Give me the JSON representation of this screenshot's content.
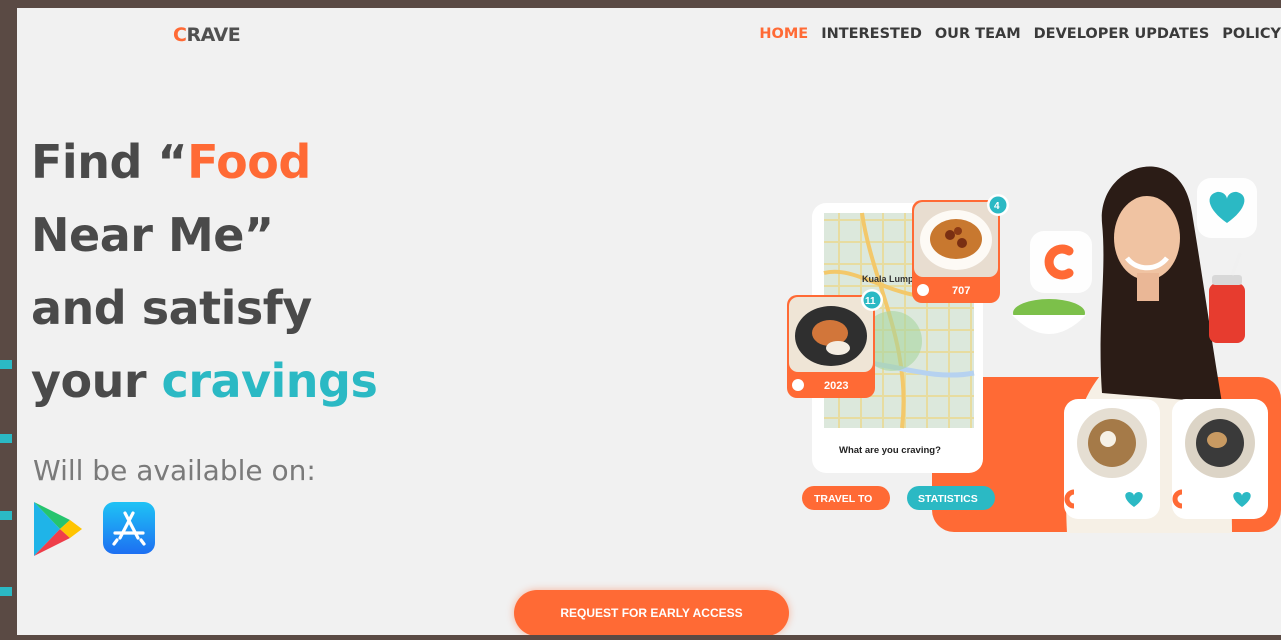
{
  "brand": {
    "logo_first": "C",
    "logo_rest": "RAVE"
  },
  "nav": {
    "items": [
      {
        "label": "HOME",
        "active": true
      },
      {
        "label": "INTERESTED",
        "active": false
      },
      {
        "label": "OUR TEAM",
        "active": false
      },
      {
        "label": "DEVELOPER UPDATES",
        "active": false
      },
      {
        "label": "POLICY",
        "active": false
      }
    ]
  },
  "hero": {
    "line1_a": "Find “",
    "line1_b": "Food",
    "line2": "Near Me”",
    "line3": "and satisfy",
    "line4_a": "your ",
    "line4_b": "cravings",
    "available": "Will be available on:"
  },
  "stores": {
    "play_icon": "google-play-icon",
    "appstore_icon": "app-store-icon"
  },
  "cta": {
    "label": "REQUEST FOR EARLY ACCESS"
  },
  "illustration": {
    "map_label": "Kuala Lump",
    "badge_top": "4",
    "badge_left": "11",
    "count_top": "707",
    "count_left": "2023",
    "search_text": "What are you craving?",
    "pill_travel": "TRAVEL TO",
    "pill_stats": "STATISTICS"
  },
  "colors": {
    "accent": "#ff6a35",
    "teal": "#2bb9c4",
    "text": "#4a4a4a",
    "frame": "#5a4a44",
    "background": "#f1f1f1"
  }
}
